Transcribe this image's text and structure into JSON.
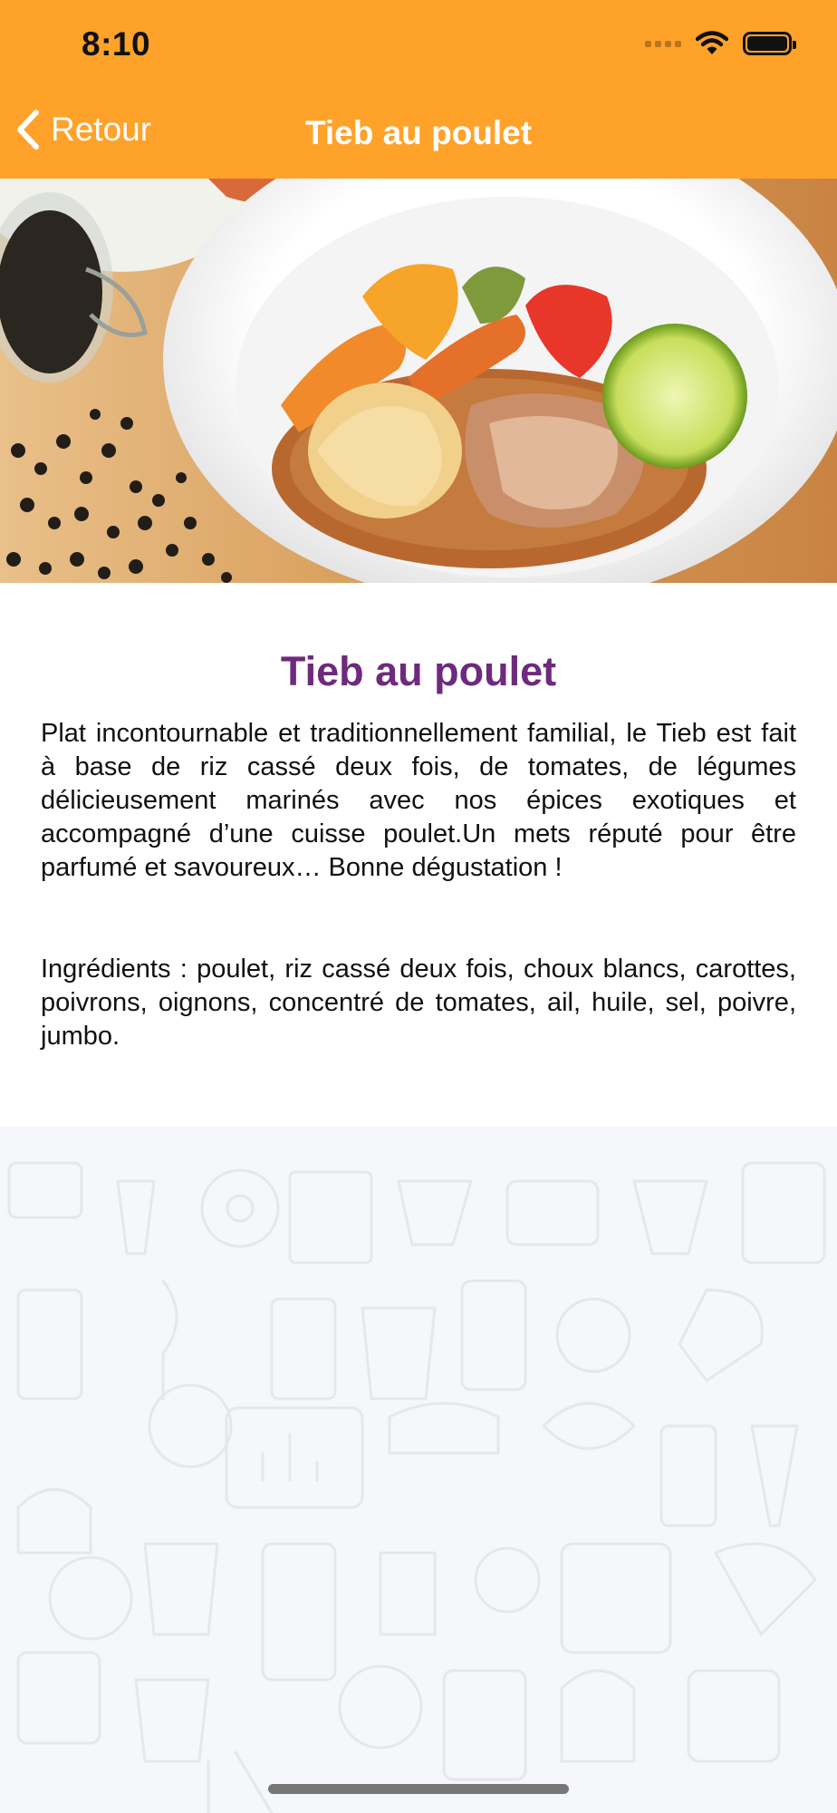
{
  "status_bar": {
    "time": "8:10"
  },
  "nav": {
    "back_label": "Retour",
    "title": "Tieb au poulet"
  },
  "dish": {
    "title": "Tieb au poulet",
    "description": "Plat incontournable et traditionnellement familial, le Tieb est fait à base de riz cassé deux fois, de tomates, de légumes délicieusement marinés avec nos épices exotiques et accompagné d’une cuisse poulet.Un mets réputé pour être parfumé et savoureux… Bonne dégustation !",
    "ingredients": "Ingrédients : poulet, riz cassé deux fois, choux blancs, carottes, poivrons, oignons, concentré de tomates, ail, huile, sel, poivre, jumbo."
  },
  "colors": {
    "accent": "#ffa22a",
    "title": "#6e2a7d"
  }
}
